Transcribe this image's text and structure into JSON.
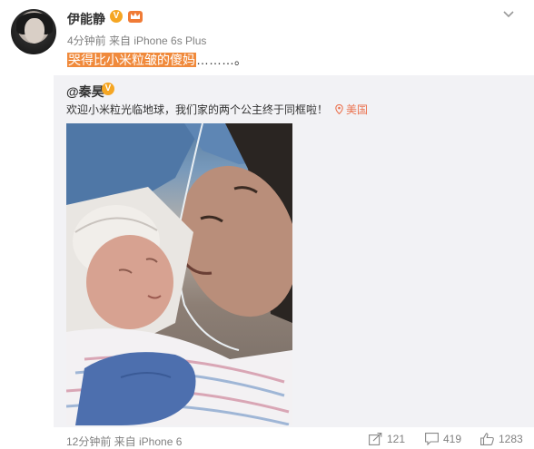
{
  "post": {
    "username": "伊能静",
    "meta": "4分钟前 来自 iPhone 6s Plus",
    "text_highlight": "哭得比小米粒皱的傻妈",
    "text_rest": "………。"
  },
  "repost": {
    "username": "@秦昊",
    "text": "欢迎小米粒光临地球，我们家的两个公主终于同框啦！",
    "location": "美国",
    "meta": "12分钟前 来自 iPhone 6",
    "share_count": "121",
    "comment_count": "419",
    "like_count": "1283"
  },
  "colors": {
    "verified_badge": "#f5a623",
    "highlight": "#f08a3c",
    "location": "#eb7350"
  },
  "icons": {
    "verified": "verified-badge-icon",
    "medal": "member-crown-icon",
    "menu": "chevron-down-icon",
    "location": "location-pin-icon",
    "share": "share-icon",
    "comment": "comment-icon",
    "like": "like-icon"
  }
}
